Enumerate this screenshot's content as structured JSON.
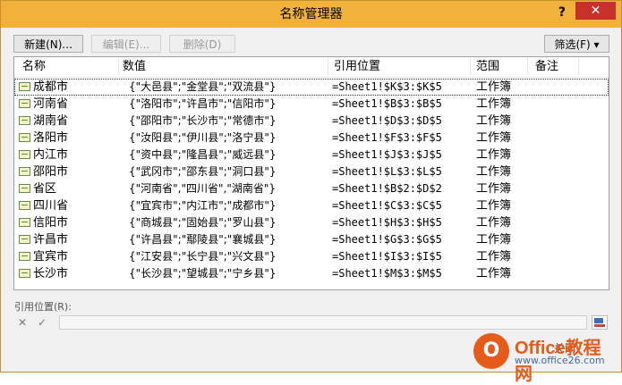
{
  "window": {
    "title": "名称管理器",
    "help": "?",
    "close": "✕"
  },
  "toolbar": {
    "new": "新建(N)...",
    "edit": "编辑(E)...",
    "delete": "删除(D)",
    "filter": "筛选(F) ▾"
  },
  "columns": {
    "name": "名称",
    "value": "数值",
    "ref": "引用位置",
    "scope": "范围",
    "note": "备注"
  },
  "rows": [
    {
      "name": "成都市",
      "value": "{\"大邑县\";\"金堂县\";\"双流县\"}",
      "ref": "=Sheet1!$K$3:$K$5",
      "scope": "工作簿"
    },
    {
      "name": "河南省",
      "value": "{\"洛阳市\";\"许昌市\";\"信阳市\"}",
      "ref": "=Sheet1!$B$3:$B$5",
      "scope": "工作簿"
    },
    {
      "name": "湖南省",
      "value": "{\"邵阳市\";\"长沙市\";\"常德市\"}",
      "ref": "=Sheet1!$D$3:$D$5",
      "scope": "工作簿"
    },
    {
      "name": "洛阳市",
      "value": "{\"汝阳县\";\"伊川县\";\"洛宁县\"}",
      "ref": "=Sheet1!$F$3:$F$5",
      "scope": "工作簿"
    },
    {
      "name": "内江市",
      "value": "{\"资中县\";\"隆昌县\";\"威远县\"}",
      "ref": "=Sheet1!$J$3:$J$5",
      "scope": "工作簿"
    },
    {
      "name": "邵阳市",
      "value": "{\"武冈市\";\"邵东县\";\"洞口县\"}",
      "ref": "=Sheet1!$L$3:$L$5",
      "scope": "工作簿"
    },
    {
      "name": "省区",
      "value": "{\"河南省\",\"四川省\",\"湖南省\"}",
      "ref": "=Sheet1!$B$2:$D$2",
      "scope": "工作簿"
    },
    {
      "name": "四川省",
      "value": "{\"宜宾市\";\"内江市\";\"成都市\"}",
      "ref": "=Sheet1!$C$3:$C$5",
      "scope": "工作簿"
    },
    {
      "name": "信阳市",
      "value": "{\"商城县\";\"固始县\";\"罗山县\"}",
      "ref": "=Sheet1!$H$3:$H$5",
      "scope": "工作簿"
    },
    {
      "name": "许昌市",
      "value": "{\"许昌县\";\"鄢陵县\";\"襄城县\"}",
      "ref": "=Sheet1!$G$3:$G$5",
      "scope": "工作簿"
    },
    {
      "name": "宜宾市",
      "value": "{\"江安县\";\"长宁县\";\"兴文县\"}",
      "ref": "=Sheet1!$I$3:$I$5",
      "scope": "工作簿"
    },
    {
      "name": "长沙市",
      "value": "{\"长沙县\";\"望城县\";\"宁乡县\"}",
      "ref": "=Sheet1!$M$3:$M$5",
      "scope": "工作簿"
    }
  ],
  "refbar": {
    "label": "引用位置(R):",
    "cancel": "✕",
    "confirm": "✓",
    "close": "关闭"
  },
  "watermark": {
    "mark": "O",
    "main": "Office教程网",
    "sub": "www.office26.com"
  },
  "colors": {
    "titlebar": "#f2b13a",
    "close": "#c7312a",
    "accent": "#e55b19"
  }
}
